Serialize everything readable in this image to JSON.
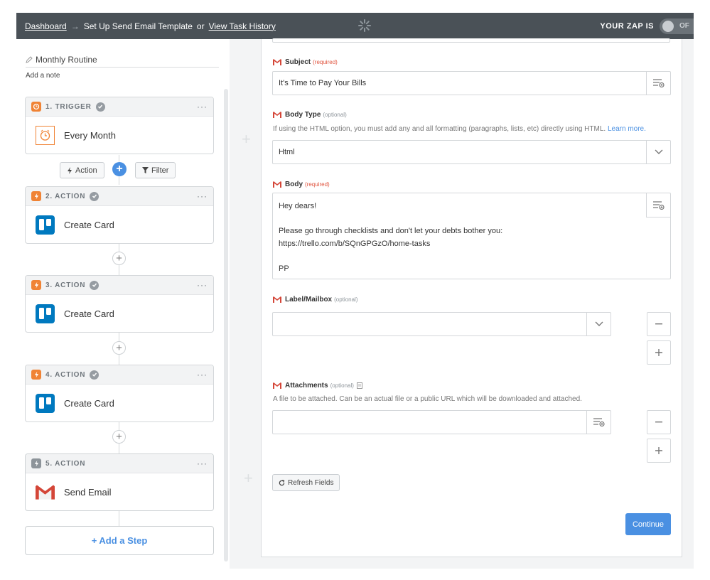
{
  "header": {
    "dashboard_link": "Dashboard",
    "arrow": "→",
    "title": "Set Up Send Email Template",
    "or_text": "or",
    "history_link": "View Task History",
    "zap_label": "YOUR ZAP IS",
    "toggle_text": "OF"
  },
  "sidebar": {
    "zap_name": "Monthly Routine",
    "add_note": "Add a note",
    "steps": [
      {
        "label": "1. TRIGGER",
        "title": "Every Month",
        "app_icon": "clock-icon",
        "badge_icon": "schedule-icon"
      },
      {
        "label": "2. ACTION",
        "title": "Create Card",
        "app_icon": "trello-icon",
        "badge_icon": "bolt-icon"
      },
      {
        "label": "3. ACTION",
        "title": "Create Card",
        "app_icon": "trello-icon",
        "badge_icon": "bolt-icon"
      },
      {
        "label": "4. ACTION",
        "title": "Create Card",
        "app_icon": "trello-icon",
        "badge_icon": "bolt-icon"
      },
      {
        "label": "5. ACTION",
        "title": "Send Email",
        "app_icon": "gmail-icon",
        "badge_icon": "bolt-icon"
      }
    ],
    "dots": "···",
    "action_button": "Action",
    "filter_button": "Filter",
    "add_step": "+ Add a Step"
  },
  "form": {
    "subject": {
      "label": "Subject",
      "tag": "(required)",
      "value": "It's Time to Pay Your Bills"
    },
    "body_type": {
      "label": "Body Type",
      "tag": "(optional)",
      "help": "If using the HTML option, you must add any and all formatting (paragraphs, lists, etc) directly using HTML.",
      "help_link": "Learn more.",
      "value": "Html"
    },
    "body": {
      "label": "Body",
      "tag": "(required)",
      "lines": [
        "Hey dears!",
        "",
        "Please go through checklists and don't let your debts bother you:",
        "https://trello.com/b/SQnGPGzO/home-tasks",
        "",
        "PP"
      ]
    },
    "label_mailbox": {
      "label": "Label/Mailbox",
      "tag": "(optional)",
      "value": ""
    },
    "attachments": {
      "label": "Attachments",
      "tag": "(optional)",
      "help": "A file to be attached. Can be an actual file or a public URL which will be downloaded and attached.",
      "value": ""
    },
    "refresh_button": "Refresh Fields",
    "continue_button": "Continue"
  },
  "colors": {
    "header_bg": "#4a5157",
    "accent": "#4a90e2",
    "trigger_orange": "#f08335",
    "required_red": "#e0533d",
    "trello_blue": "#0079bf",
    "gmail_red": "#d44638"
  }
}
